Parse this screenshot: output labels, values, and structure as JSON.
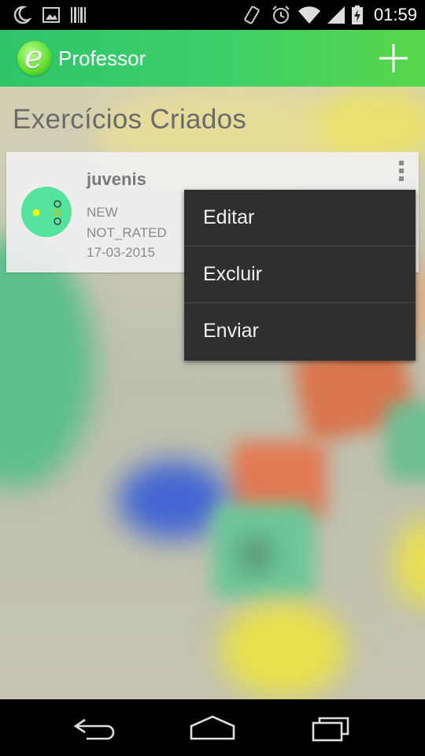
{
  "status_bar": {
    "time": "01:59",
    "icons": [
      "moon-icon",
      "image-icon",
      "barcode-icon",
      "vibrate-icon",
      "alarm-icon",
      "wifi-icon",
      "signal-icon",
      "battery-icon"
    ]
  },
  "action_bar": {
    "app_title": "Professor",
    "logo_letter": "e",
    "add_icon": "plus-icon",
    "accent": "#3ccf6a"
  },
  "main": {
    "section_title": "Exercícios Criados",
    "card": {
      "name": "juvenis",
      "status": "NEW",
      "rating": "NOT_RATED",
      "date": "17-03-2015",
      "avatar_color": "#53e39c",
      "overflow_icon": "overflow-menu-icon"
    }
  },
  "popup_menu": {
    "items": [
      {
        "label": "Editar"
      },
      {
        "label": "Excluir"
      },
      {
        "label": "Enviar"
      }
    ]
  },
  "nav_bar": {
    "icons": [
      "back-icon",
      "home-icon",
      "recents-icon"
    ]
  }
}
